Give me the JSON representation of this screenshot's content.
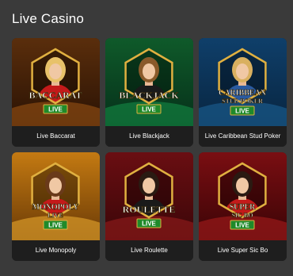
{
  "section": {
    "title": "Live Casino"
  },
  "live_badge": "LIVE",
  "games": [
    {
      "name": "Live Baccarat",
      "logo_lines": [
        "BACCARAT"
      ],
      "bg_top": "#5a2e0c",
      "bg_bottom": "#2a1204",
      "table": "#8a4a12",
      "dress": "#c41a1a",
      "hair": "#e8c26a"
    },
    {
      "name": "Live Blackjack",
      "logo_lines": [
        "BLACKJACK"
      ],
      "bg_top": "#0f5a2a",
      "bg_bottom": "#06301a",
      "table": "#128040",
      "dress": "#1a1a1a",
      "hair": "#8a5a2a"
    },
    {
      "name": "Live Caribbean Stud Poker",
      "logo_lines": [
        "CARIBBEAN",
        "STUD POKER"
      ],
      "bg_top": "#0f3f6a",
      "bg_bottom": "#082540",
      "table": "#1a5a8a",
      "dress": "#2a5aa0",
      "hair": "#d9b060"
    },
    {
      "name": "Live Monopoly",
      "logo_lines": [
        "MONOPOLY",
        "LIVE"
      ],
      "bg_top": "#c47a12",
      "bg_bottom": "#6a3a06",
      "table": "#d99a2a",
      "dress": "#c41a1a",
      "hair": "#6a3a1a"
    },
    {
      "name": "Live Roulette",
      "logo_lines": [
        "ROULETTE"
      ],
      "bg_top": "#6a0e12",
      "bg_bottom": "#3a0608",
      "table": "#8a1a1a",
      "dress": "#1a1a1a",
      "hair": "#2a1a12"
    },
    {
      "name": "Live Super Sic Bo",
      "logo_lines": [
        "SUPER",
        "SIC BO"
      ],
      "bg_top": "#7a0e12",
      "bg_bottom": "#3a0406",
      "table": "#9a1a1a",
      "dress": "#c41a1a",
      "hair": "#2a1a12"
    }
  ],
  "colors": {
    "page_bg": "#3a3a3a",
    "caption_bg": "#1e1e1e",
    "live_green": "#1f8a2a",
    "gold": "#e0b040"
  }
}
